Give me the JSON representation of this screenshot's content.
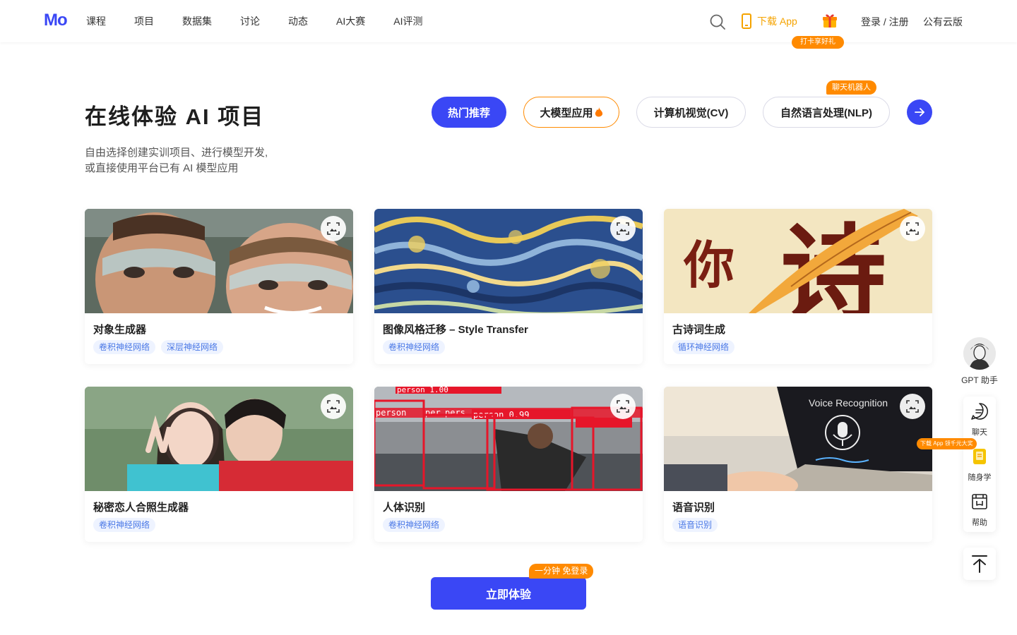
{
  "header": {
    "logo": "Mo",
    "nav": [
      "课程",
      "项目",
      "数据集",
      "讨论",
      "动态",
      "AI大赛",
      "AI评测"
    ],
    "download_label": "下载 App",
    "gift_badge": "打卡享好礼",
    "login_label": "登录 / 注册",
    "cloud_label": "公有云版"
  },
  "section": {
    "title": "在线体验 AI 项目",
    "desc_line1": "自由选择创建实训项目、进行模型开发,",
    "desc_line2": "或直接使用平台已有 AI 模型应用"
  },
  "tabs": [
    {
      "label": "热门推荐"
    },
    {
      "label": "大模型应用"
    },
    {
      "label": "计算机视觉(CV)"
    },
    {
      "label": "自然语言处理(NLP)"
    }
  ],
  "tab_badge": "聊天机器人",
  "cards": [
    {
      "title": "对象生成器",
      "tags": [
        "卷积神经网络",
        "深层神经网络"
      ]
    },
    {
      "title": "图像风格迁移 – Style Transfer",
      "tags": [
        "卷积神经网络"
      ]
    },
    {
      "title": "古诗词生成",
      "tags": [
        "循环神经网络"
      ]
    },
    {
      "title": "秘密恋人合照生成器",
      "tags": [
        "卷积神经网络"
      ]
    },
    {
      "title": "人体识别",
      "tags": [
        "卷积神经网络"
      ]
    },
    {
      "title": "语音识别",
      "tags": [
        "语音识别"
      ]
    }
  ],
  "thumb_text": {
    "poem_chars": [
      "你",
      "诗"
    ],
    "detect_1": "person 1.00",
    "detect_2": "person 0.99",
    "detect_3": "per",
    "detect_4": "pers",
    "detect_5": "person",
    "voice": "Voice Recognition"
  },
  "cta": {
    "label": "立即体验",
    "badge": "一分钟 免登录"
  },
  "rail": {
    "gpt_label": "GPT 助手",
    "chat_label": "聊天",
    "learn_label": "随身学",
    "learn_badge": "下载 App 领千元大奖",
    "help_label": "帮助"
  },
  "colors": {
    "primary": "#3a47f5",
    "accent": "#ff8a00",
    "tag_bg": "#eef3ff",
    "tag_text": "#4a78e6"
  }
}
